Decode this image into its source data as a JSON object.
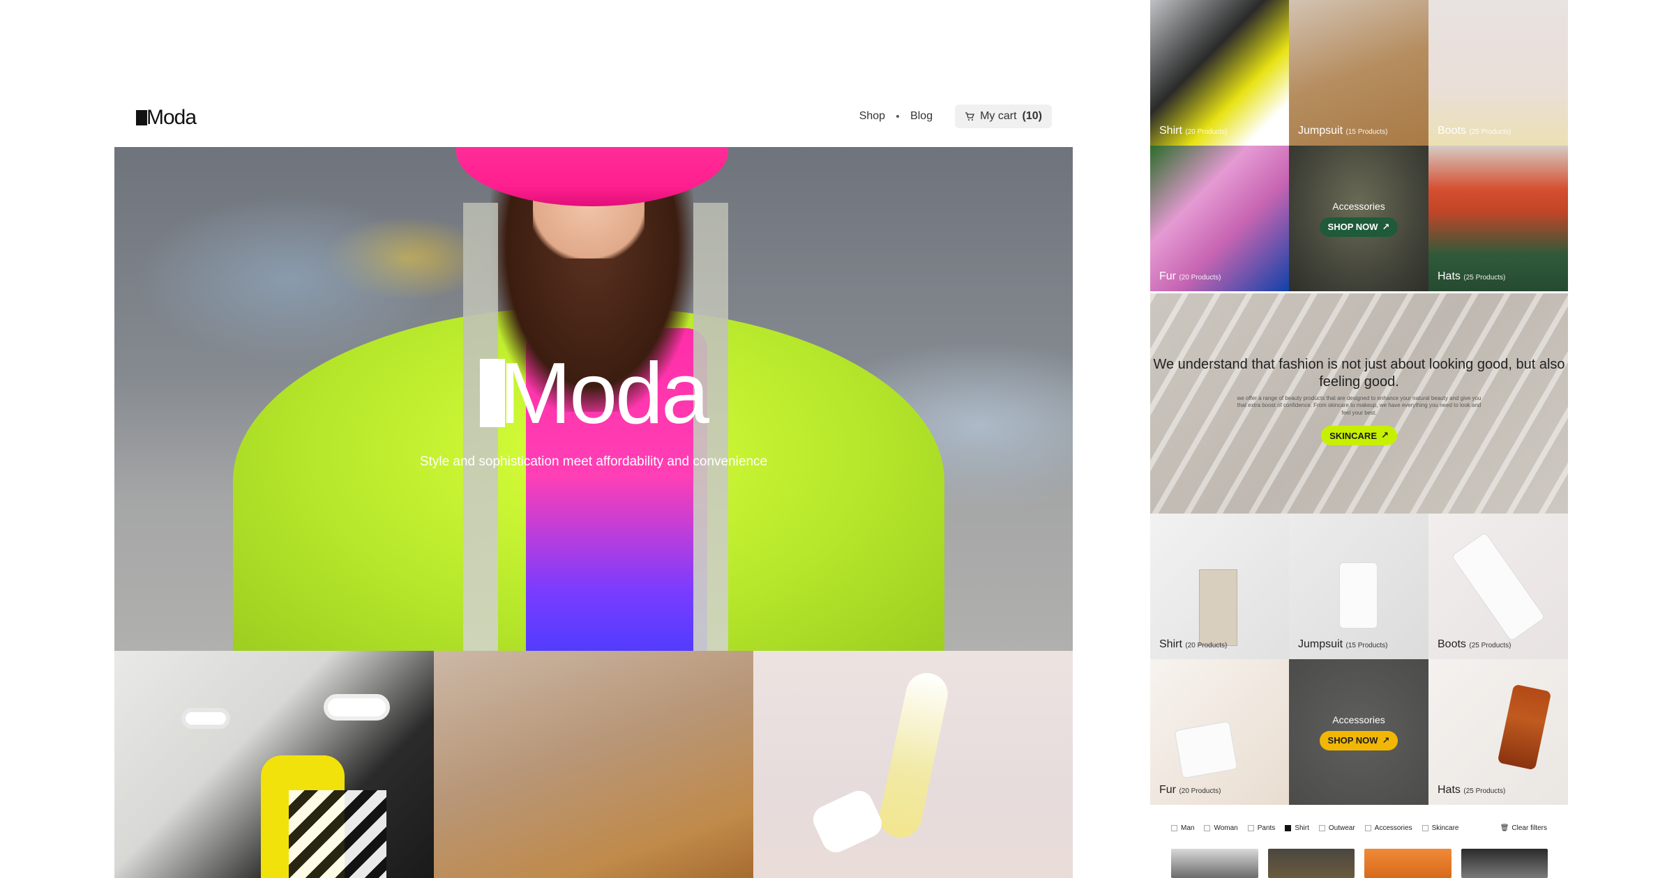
{
  "header": {
    "logo": "Moda",
    "nav": [
      "Shop",
      "Blog"
    ],
    "cart_label": "My cart",
    "cart_count": "(10)"
  },
  "hero": {
    "title": "Moda",
    "subtitle": "Style and sophistication meet affordability and convenience"
  },
  "upper_grid": [
    {
      "name": "Shirt",
      "count": "(20 Products)"
    },
    {
      "name": "Jumpsuit",
      "count": "(15 Products)"
    },
    {
      "name": "Boots",
      "count": "(25 Products)"
    },
    {
      "name": "Fur",
      "count": "(20 Products)"
    },
    {
      "name": "Accessories",
      "cta": "SHOP NOW"
    },
    {
      "name": "Hats",
      "count": "(25 Products)"
    }
  ],
  "banner": {
    "heading": "We understand that fashion is not just about looking good, but also feeling good.",
    "body": "we offer a range of beauty products that are designed to enhance your natural beauty and give you that extra boost of confidence. From skincare to makeup, we have everything you need to look and feel your best.",
    "cta": "SKINCARE"
  },
  "lower_grid": [
    {
      "name": "Shirt",
      "count": "(20 Products)"
    },
    {
      "name": "Jumpsuit",
      "count": "(15 Products)"
    },
    {
      "name": "Boots",
      "count": "(25 Products)"
    },
    {
      "name": "Fur",
      "count": "(20 Products)"
    },
    {
      "name": "Accessories",
      "cta": "SHOP NOW"
    },
    {
      "name": "Hats",
      "count": "(25 Products)"
    }
  ],
  "filters": {
    "options": [
      {
        "label": "Man",
        "checked": false
      },
      {
        "label": "Woman",
        "checked": false
      },
      {
        "label": "Pants",
        "checked": false
      },
      {
        "label": "Shirt",
        "checked": true
      },
      {
        "label": "Outwear",
        "checked": false
      },
      {
        "label": "Accessories",
        "checked": false
      },
      {
        "label": "Skincare",
        "checked": false
      }
    ],
    "clear_label": "Clear filters"
  },
  "colors": {
    "accent_green": "#1f5a3a",
    "accent_orange": "#f2b705",
    "accent_lime": "#c7f000"
  }
}
